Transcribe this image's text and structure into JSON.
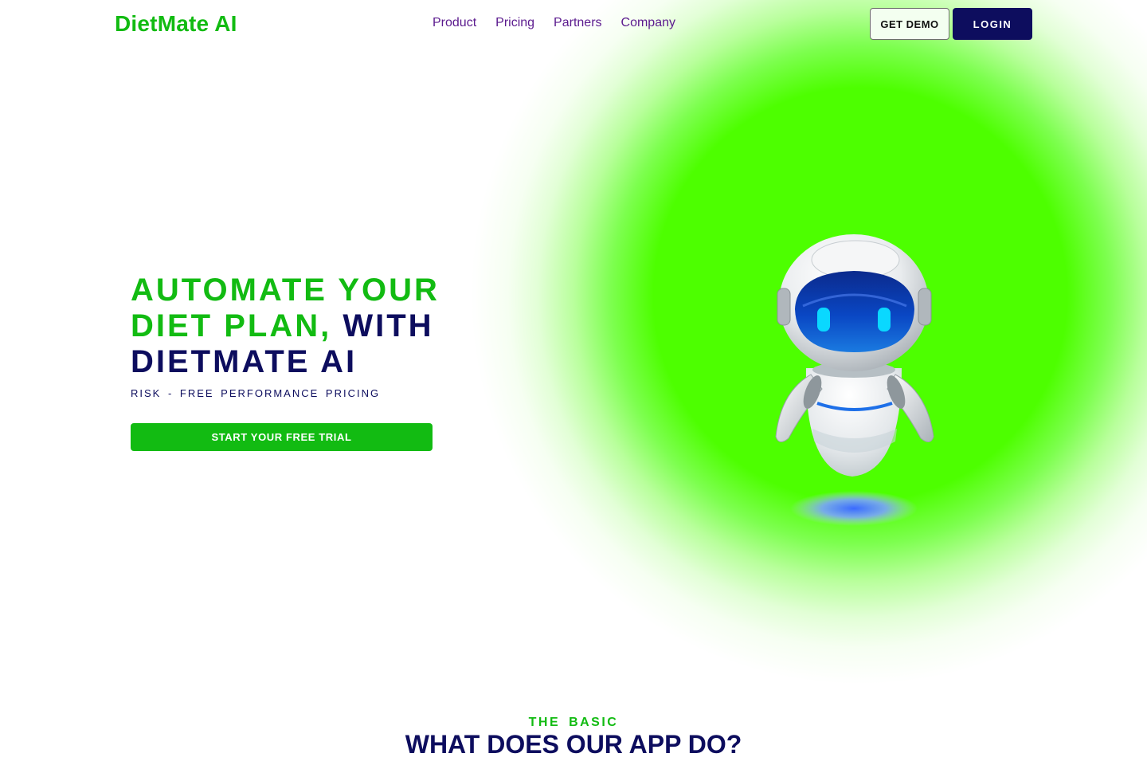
{
  "brand": {
    "name": "DietMate AI",
    "primary_color": "#12bb12",
    "navy_color": "#0d0d5e",
    "glow_color": "#4dff00"
  },
  "nav": {
    "items": [
      {
        "label": "Product"
      },
      {
        "label": "Pricing"
      },
      {
        "label": "Partners"
      },
      {
        "label": "Company"
      }
    ]
  },
  "header_actions": {
    "demo_label": "GET DEMO",
    "login_label": "LOGIN"
  },
  "hero": {
    "title_green": "AUTOMATE YOUR DIET PLAN,",
    "title_navy": "WITH DIETMATE AI",
    "subtitle": "RISK - FREE PERFORMANCE PRICING",
    "cta_label": "START YOUR FREE TRIAL",
    "illustration": "robot-icon"
  },
  "basics": {
    "eyebrow": "THE BASIC",
    "title": "WHAT DOES OUR APP DO?"
  }
}
